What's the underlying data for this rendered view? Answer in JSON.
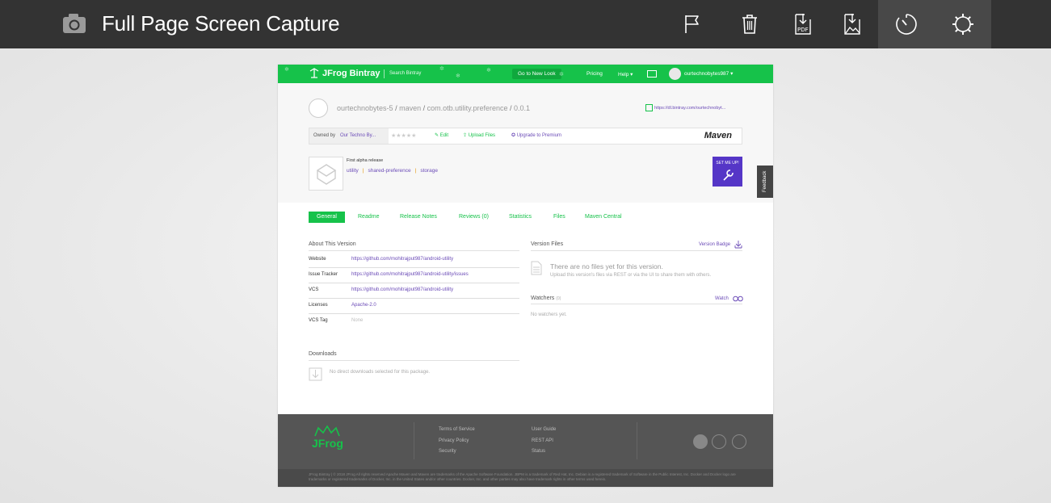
{
  "toolbar": {
    "title": "Full Page Screen Capture",
    "icons": [
      "camera-icon",
      "flag-icon",
      "trash-icon",
      "pdf-download-icon",
      "image-download-icon",
      "timer-icon",
      "settings-gear-icon"
    ],
    "pdf_icon_text": "PDF"
  },
  "capture": {
    "nav": {
      "logo": "JFrog Bintray",
      "search_placeholder": "Search Bintray",
      "new_look": "Go to New Look",
      "pricing": "Pricing",
      "help": "Help ▾",
      "user": "ourtechnobytes987 ▾"
    },
    "breadcrumb": {
      "owner": "ourtechnobytes-5",
      "repo": "maven",
      "package": "com.otb.utility.preference",
      "version": "0.0.1"
    },
    "download_url": "https://dl.bintray.com/ourtechnobyt...",
    "owned_by_label": "Owned by",
    "owned_by_value": "Our Techno By...",
    "stars": "★★★★★",
    "edit": "Edit",
    "upload": "Upload Files",
    "upgrade": "Upgrade to Premium",
    "maven": "Maven",
    "description": "First alpha release",
    "tags": [
      "utility",
      "shared-preference",
      "storage"
    ],
    "set_me_up": "SET ME UP!",
    "feedback": "Feedback",
    "tabs": [
      "General",
      "Readme",
      "Release Notes",
      "Reviews (0)",
      "Statistics",
      "Files",
      "Maven Central"
    ],
    "about": {
      "title": "About This Version",
      "rows": [
        {
          "k": "Website",
          "v": "https://github.com/mohitrajput987/android-utility"
        },
        {
          "k": "Issue Tracker",
          "v": "https://github.com/mohitrajput987/android-utility/issues"
        },
        {
          "k": "VCS",
          "v": "https://github.com/mohitrajput987/android-utility"
        },
        {
          "k": "Licenses",
          "v": "Apache-2.0"
        },
        {
          "k": "VCS Tag",
          "v": "None"
        }
      ]
    },
    "version_files": {
      "title": "Version Files",
      "badge": "Version Badge",
      "empty": "There are no files yet for this version.",
      "hint": "Upload this version's files via REST or via the UI to share them with others."
    },
    "watchers": {
      "title": "Watchers",
      "count": "(0)",
      "watch": "Watch",
      "empty": "No watchers yet."
    },
    "downloads": {
      "title": "Downloads",
      "empty": "No direct downloads selected for this package."
    },
    "footer": {
      "logo": "JFrog",
      "col1": [
        "Terms of Service",
        "Privacy Policy",
        "Security"
      ],
      "col2": [
        "User Guide",
        "REST API",
        "Status"
      ],
      "copyright": "JFrog Bintray | © 2018 JFrog All rights reserved Apache Maven and Maven are trademarks of the Apache Software Foundation. JBPM is a trademark of Red Hat, Inc. Debian is a registered trademark of Software in the Public Interest, Inc. Docker and Docker logo are trademarks or registered trademarks of Docker, Inc. in the United States and/or other countries. Docker, Inc. and other parties may also have trademark rights in other terms used herein."
    }
  },
  "colors": {
    "toolbar_bg": "#333333",
    "bintray_green": "#16c24a",
    "link_purple": "#6b4bb7"
  }
}
